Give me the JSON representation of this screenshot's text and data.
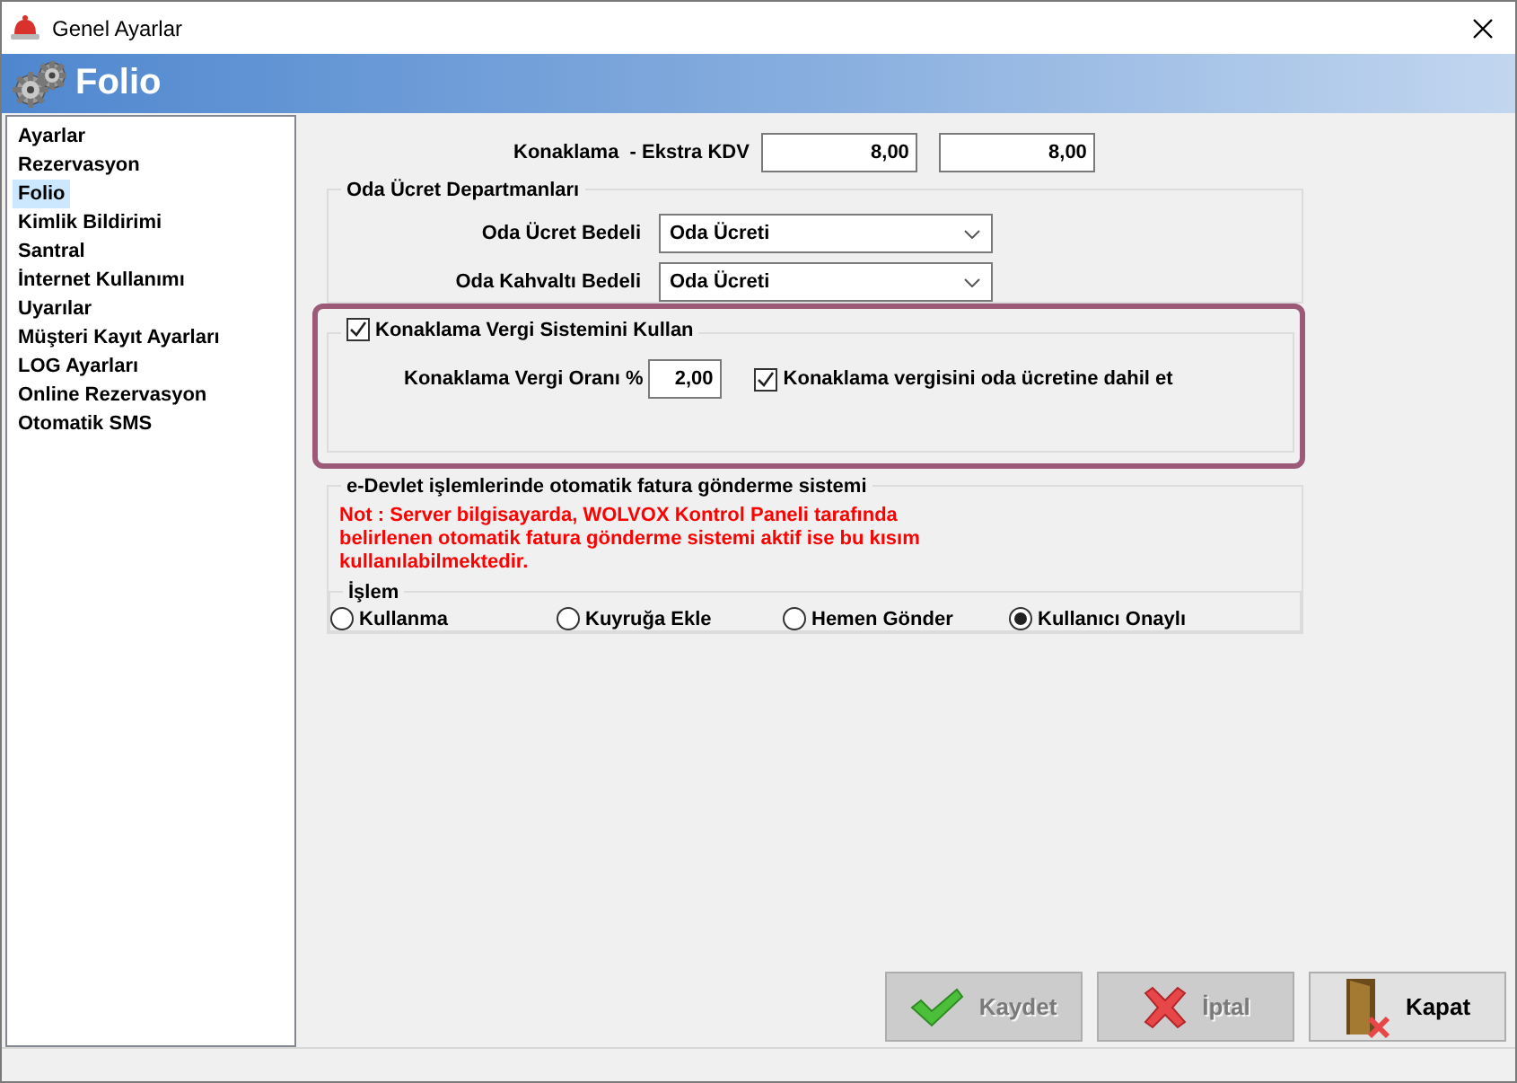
{
  "window": {
    "title": "Genel Ayarlar"
  },
  "header": {
    "title": "Folio"
  },
  "sidebar": {
    "items": [
      {
        "label": "Ayarlar",
        "selected": false
      },
      {
        "label": "Rezervasyon",
        "selected": false
      },
      {
        "label": "Folio",
        "selected": true
      },
      {
        "label": "Kimlik Bildirimi",
        "selected": false
      },
      {
        "label": "Santral",
        "selected": false
      },
      {
        "label": "İnternet Kullanımı",
        "selected": false
      },
      {
        "label": "Uyarılar",
        "selected": false
      },
      {
        "label": "Müşteri Kayıt Ayarları",
        "selected": false
      },
      {
        "label": "LOG Ayarları",
        "selected": false
      },
      {
        "label": "Online Rezervasyon",
        "selected": false
      },
      {
        "label": "Otomatik SMS",
        "selected": false
      }
    ]
  },
  "kdv": {
    "label": "Konaklama  - Ekstra KDV",
    "values": [
      "8,00",
      "8,00"
    ]
  },
  "room_departments": {
    "title": "Oda Ücret Departmanları",
    "fields": [
      {
        "label": "Oda Ücret Bedeli",
        "value": "Oda Ücreti"
      },
      {
        "label": "Oda Kahvaltı Bedeli",
        "value": "Oda Ücreti"
      }
    ]
  },
  "tax_system": {
    "label": "Konaklama Vergi Sistemini Kullan",
    "checked": true,
    "rate_label": "Konaklama Vergi Oranı %",
    "rate": "2,00",
    "include": {
      "label": "Konaklama vergisini oda ücretine dahil et",
      "checked": true
    }
  },
  "e_devlet": {
    "title": "e-Devlet işlemlerinde otomatik fatura gönderme sistemi",
    "note": "Not : Server bilgisayarda, WOLVOX Kontrol Paneli tarafında belirlenen otomatik fatura gönderme sistemi aktif ise bu kısım kullanılabilmektedir.",
    "group": {
      "title": "İşlem",
      "options": [
        {
          "label": "Kullanma",
          "selected": false
        },
        {
          "label": "Kuyruğa Ekle",
          "selected": false
        },
        {
          "label": "Hemen Gönder",
          "selected": false
        },
        {
          "label": "Kullanıcı Onaylı",
          "selected": true
        }
      ]
    }
  },
  "buttons": [
    {
      "kind": "save",
      "label": "Kaydet",
      "disabled": true
    },
    {
      "kind": "cancel",
      "label": "İptal",
      "disabled": true
    },
    {
      "kind": "close",
      "label": "Kapat",
      "disabled": false
    }
  ]
}
